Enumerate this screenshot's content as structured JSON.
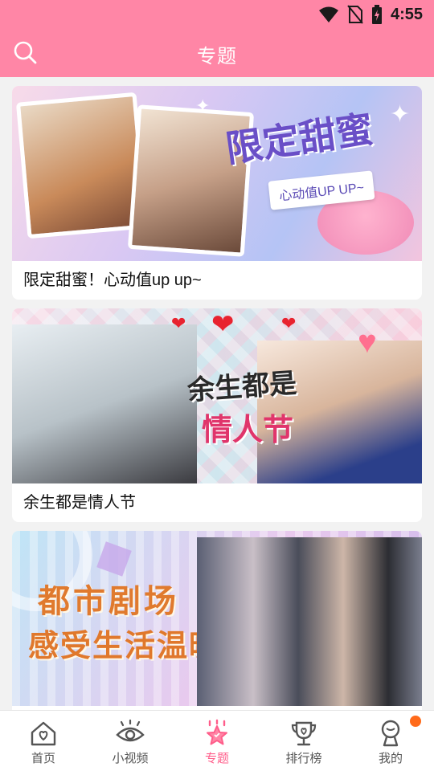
{
  "status_bar": {
    "time": "4:55"
  },
  "app_bar": {
    "title": "专题"
  },
  "topics": [
    {
      "caption": "限定甜蜜！心动值up up~",
      "banner_title": "限定甜蜜",
      "banner_subtitle": "心动值UP UP~"
    },
    {
      "caption": "余生都是情人节",
      "banner_title_line1": "余生都是",
      "banner_title_line2": "情人节"
    },
    {
      "caption": "",
      "banner_title_line1": "都市剧场",
      "banner_title_line2": "感受生活温暖"
    }
  ],
  "tabs": [
    {
      "label": "首页",
      "icon": "home-heart-icon"
    },
    {
      "label": "小视频",
      "icon": "eye-icon"
    },
    {
      "label": "专题",
      "icon": "star-icon"
    },
    {
      "label": "排行榜",
      "icon": "trophy-icon"
    },
    {
      "label": "我的",
      "icon": "profile-icon"
    }
  ],
  "colors": {
    "primary": "#ff86a6",
    "active_tab": "#ff5d8a",
    "badge": "#ff6a1a"
  }
}
